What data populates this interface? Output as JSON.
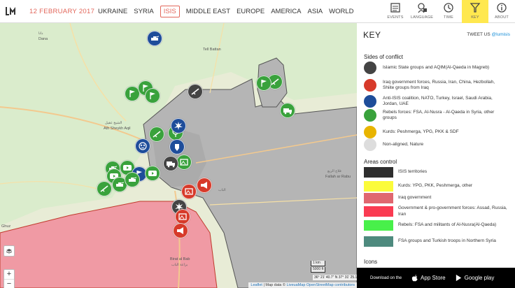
{
  "header": {
    "date": "12 FEBRUARY 2017",
    "nav": [
      {
        "label": "UKRAINE",
        "active": false
      },
      {
        "label": "SYRIA",
        "active": false
      },
      {
        "label": "ISIS",
        "active": true
      },
      {
        "label": "MIDDLE EAST",
        "active": false
      },
      {
        "label": "EUROPE",
        "active": false
      },
      {
        "label": "AMERICA",
        "active": false
      },
      {
        "label": "ASIA",
        "active": false
      },
      {
        "label": "WORLD",
        "active": false
      }
    ],
    "tools": [
      {
        "label": "EVENTS",
        "icon": "events-icon"
      },
      {
        "label": "LANGUAGE",
        "icon": "language-icon"
      },
      {
        "label": "TIME",
        "icon": "time-icon"
      },
      {
        "label": "KEY",
        "icon": "key-icon",
        "active": true
      },
      {
        "label": "ABOUT",
        "icon": "about-icon"
      }
    ]
  },
  "map": {
    "towns": [
      {
        "name": "Dana",
        "ar": "دانا"
      },
      {
        "name": "Tell Battan",
        "ar": ""
      },
      {
        "name": "Ath Sheykh Aqil",
        "ar": "الشيخ عقيل"
      },
      {
        "name": "Fallah ar Rabu",
        "ar": "فلاح الربع"
      },
      {
        "name": "Ghuz",
        "ar": ""
      },
      {
        "name": "Birat al Bab",
        "ar": "بزاعة الباب"
      },
      {
        "name": "Al Bab",
        "ar": "الباب"
      }
    ],
    "scale": {
      "metric": "1 km",
      "imperial": "5000 ft"
    },
    "coordinates": "36° 21' 40.7\" N 37° 31' 25.1\" E",
    "attribution": {
      "leaflet": "Leaflet",
      "sep": " | Map data © ",
      "links": "LiveuaMap OpenStreetMap contributors"
    },
    "zoom": {
      "in": "+",
      "out": "−"
    }
  },
  "key": {
    "title": "KEY",
    "tweet_prefix": "TWEET US ",
    "tweet_handle": "@lumisis",
    "sides_title": "Sides of conflict",
    "sides": [
      {
        "color": "#444444",
        "label": "Islamic State groups and AQIM(Al-Qaeda in Magreb)"
      },
      {
        "color": "#d73a2a",
        "label": "Iraq government forces, Russia, Iran, China, Hezbollah, Shiite groups from Iraq"
      },
      {
        "color": "#1e4d9a",
        "label": "Anti-ISIS coalition, NATO, Turkey, Israel, Saudi Arabia, Jordan, UAE"
      },
      {
        "color": "#39a23c",
        "label": "Rebels forces: FSA, Al-Nusra - Al-Qaeda in Syria, other groups"
      },
      {
        "color": "#e8b400",
        "label": "Kurds: Peshmerga, YPG, PKK & SDF"
      },
      {
        "color": "#dddddd",
        "label": "Non-aligned, Nature"
      }
    ],
    "areas_title": "Areas control",
    "areas": [
      {
        "color": "#2e2e2e",
        "label": "ISIS territories"
      },
      {
        "color": "#fbfb3a",
        "label": "Kurds: YPG, PKK, Peshmerga, other"
      },
      {
        "color": "#e0676f",
        "label": "Iraq government"
      },
      {
        "color": "#fa3b52",
        "label": "Government & pro-government forces: Assad, Russia, Iran"
      },
      {
        "color": "#48f04a",
        "label": "Rebels: FSA and militants of Al-Nusra(Al-Qaeda)"
      },
      {
        "color": "#4e8a7e",
        "label": "FSA groups and Turkish troops in Northern Syria"
      }
    ],
    "icons_title": "Icons"
  },
  "appbar": {
    "download": "Download on the",
    "appstore": "App Store",
    "googleplay": "Google play"
  }
}
